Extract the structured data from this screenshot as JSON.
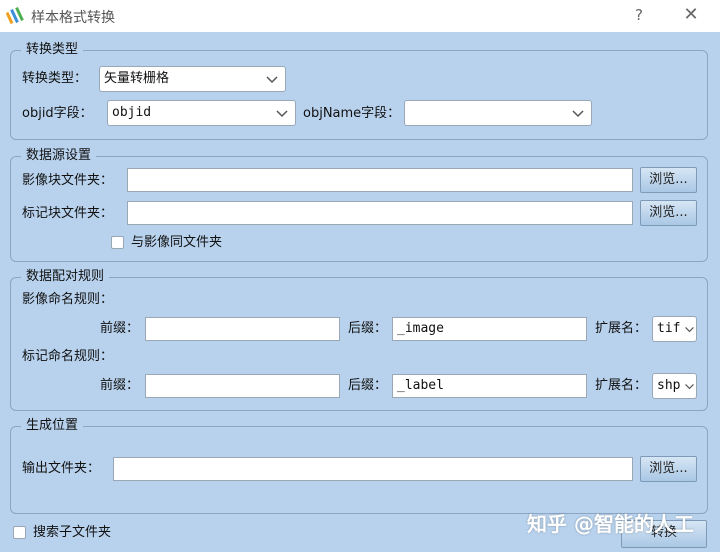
{
  "window": {
    "title": "样本格式转换",
    "help": "?",
    "close": "✕"
  },
  "conversion": {
    "group_title": "转换类型",
    "type_label": "转换类型：",
    "type_value": "矢量转栅格",
    "objid_label": "objid字段：",
    "objid_value": "objid",
    "objname_label": "objName字段：",
    "objname_value": ""
  },
  "source": {
    "group_title": "数据源设置",
    "image_label": "影像块文件夹：",
    "image_value": "",
    "browse": "浏览...",
    "label_label": "标记块文件夹：",
    "label_value": "",
    "same_folder_label": "与影像同文件夹"
  },
  "rules": {
    "group_title": "数据配对规则",
    "image_rule_label": "影像命名规则：",
    "prefix_label": "前缀：",
    "suffix_label": "后缀：",
    "ext_label": "扩展名：",
    "image_prefix": "",
    "image_suffix": "_image",
    "image_ext": "tif",
    "label_rule_label": "标记命名规则：",
    "label_prefix": "",
    "label_suffix": "_label",
    "label_ext": "shp"
  },
  "output": {
    "group_title": "生成位置",
    "folder_label": "输出文件夹：",
    "folder_value": "",
    "browse": "浏览..."
  },
  "footer": {
    "search_sub_label": "搜索子文件夹",
    "convert_button": "转换",
    "watermark": "知乎 @智能的人工"
  },
  "colors": {
    "background": "#b8d2ed",
    "titlebar": "#ffffff",
    "border": "#8aa6c4"
  }
}
